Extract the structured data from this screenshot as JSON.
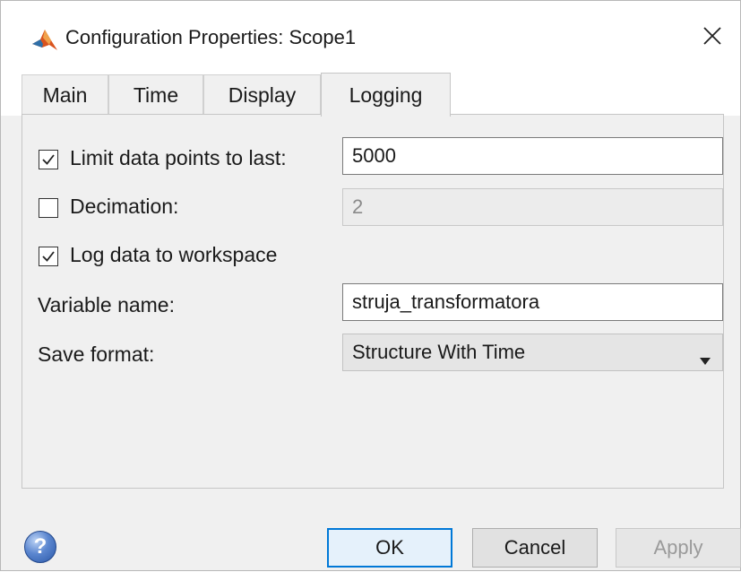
{
  "window": {
    "title": "Configuration Properties: Scope1"
  },
  "icons": {
    "app": "matlab-logo-icon",
    "close": "close-icon",
    "help": "help-icon",
    "dropdown": "chevron-down-icon"
  },
  "tabs": [
    {
      "label": "Main",
      "active": false
    },
    {
      "label": "Time",
      "active": false
    },
    {
      "label": "Display",
      "active": false
    },
    {
      "label": "Logging",
      "active": true
    }
  ],
  "logging": {
    "limit_points": {
      "label": "Limit data points to last:",
      "checked": true,
      "value": "5000"
    },
    "decimation": {
      "label": "Decimation:",
      "checked": false,
      "value": "2"
    },
    "log_to_workspace": {
      "label": "Log data to workspace",
      "checked": true
    },
    "variable_name": {
      "label": "Variable name:",
      "value": "struja_transformatora"
    },
    "save_format": {
      "label": "Save format:",
      "value": "Structure With Time"
    }
  },
  "buttons": {
    "help": "?",
    "ok": "OK",
    "cancel": "Cancel",
    "apply": "Apply"
  },
  "colors": {
    "default_button_border": "#0078d7",
    "help_icon": "#2a58a8",
    "matlab_logo": "#d9531e"
  }
}
